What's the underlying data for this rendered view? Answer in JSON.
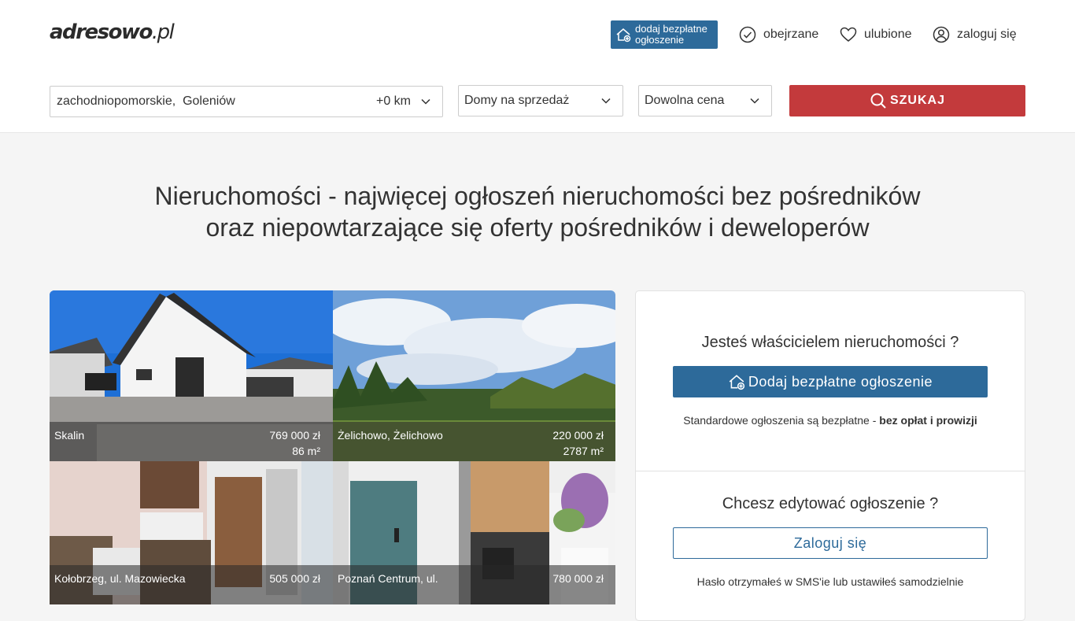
{
  "header": {
    "logo_main": "adresowo",
    "logo_tld": ".pl",
    "add_listing_line1": "dodaj bezpłatne",
    "add_listing_line2": "ogłoszenie",
    "nav_viewed": "obejrzane",
    "nav_favorites": "ulubione",
    "nav_login": "zaloguj się"
  },
  "search": {
    "location": "zachodniopomorskie,  Goleniów",
    "radius": "+0 km",
    "property_type": "Domy na sprzedaż",
    "price": "Dowolna cena",
    "button_label": "SZUKAJ"
  },
  "headline": {
    "line1": "Nieruchomości - najwięcej ogłoszeń nieruchomości bez pośredników",
    "line2": "oraz niepowtarzające się oferty pośredników i deweloperów"
  },
  "listings": [
    {
      "place": "Skalin",
      "price": "769 000 zł",
      "area": "86 m²"
    },
    {
      "place": "Żelichowo, Żelichowo",
      "price": "220 000 zł",
      "area": "2787 m²"
    },
    {
      "place": "Kołobrzeg, ul. Mazowiecka",
      "price": "505 000 zł",
      "area": ""
    },
    {
      "place": "Poznań Centrum, ul.",
      "price": "780 000 zł",
      "area": ""
    }
  ],
  "owner_panel": {
    "owner_heading": "Jesteś właścicielem nieruchomości ?",
    "add_button": "Dodaj bezpłatne ogłoszenie",
    "free_note_prefix": "Standardowe ogłoszenia są bezpłatne - ",
    "free_note_bold": "bez opłat i prowizji",
    "edit_heading": "Chcesz edytować ogłoszenie ?",
    "login_button": "Zaloguj się",
    "password_note": "Hasło otrzymałeś w SMS'ie lub ustawiłeś samodzielnie"
  },
  "colors": {
    "brand_blue": "#2d6a9a",
    "search_red": "#c33a3c"
  }
}
